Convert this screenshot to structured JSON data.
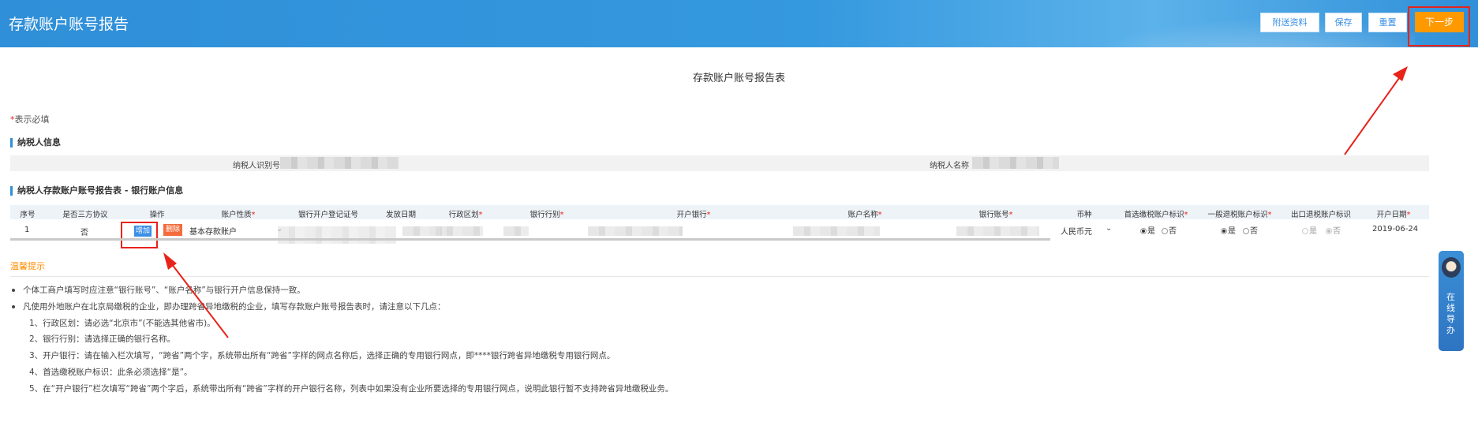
{
  "header": {
    "title": "存款账户账号报告",
    "buttons": {
      "attach": "附送资料",
      "save": "保存",
      "reset": "重置",
      "next": "下一步"
    }
  },
  "form": {
    "title": "存款账户账号报告表",
    "required_note_star": "*",
    "required_note": "表示必填",
    "section_taxpayer": "纳税人信息",
    "taxpayer_id_label": "纳税人识别号",
    "taxpayer_name_label": "纳税人名称",
    "section_bank": "纳税人存款账户账号报告表 - 银行账户信息"
  },
  "table": {
    "headers": [
      {
        "text": "序号",
        "required": false
      },
      {
        "text": "是否三方协议",
        "required": false
      },
      {
        "text": "操作",
        "required": false
      },
      {
        "text": "账户性质",
        "required": true
      },
      {
        "text": "银行开户登记证号",
        "required": false
      },
      {
        "text": "发放日期",
        "required": false
      },
      {
        "text": "行政区划",
        "required": true
      },
      {
        "text": "银行行别",
        "required": true
      },
      {
        "text": "开户银行",
        "required": true
      },
      {
        "text": "账户名称",
        "required": true
      },
      {
        "text": "银行账号",
        "required": true
      },
      {
        "text": "币种",
        "required": false
      },
      {
        "text": "首选缴税账户标识",
        "required": true
      },
      {
        "text": "一般退税账户标识",
        "required": true
      },
      {
        "text": "出口退税账户标识",
        "required": false
      },
      {
        "text": "开户日期",
        "required": true
      }
    ],
    "row": {
      "index": "1",
      "tripartite": "否",
      "add_label": "增加",
      "delete_label": "删除",
      "account_type": "基本存款账户",
      "currency": "人民币元",
      "yes": "是",
      "no": "否",
      "open_date": "2019-06-24"
    }
  },
  "tips": {
    "title": "温馨提示",
    "items": [
      "个体工商户填写时应注意“银行账号”、“账户名称”与银行开户信息保持一致。",
      "凡使用外地账户在北京局缴税的企业，即办理跨省异地缴税的企业，填写存款账户账号报告表时，请注意以下几点：",
      "1、行政区划：请必选“北京市”(不能选其他省市)。",
      "2、银行行别：请选择正确的银行名称。",
      "3、开户银行：请在输入栏次填写，“跨省”两个字，系统带出所有“跨省”字样的网点名称后，选择正确的专用银行网点，即****银行跨省异地缴税专用银行网点。",
      "4、首选缴税账户标识：此条必须选择“是”。",
      "5、在“开户银行”栏次填写“跨省”两个字后，系统带出所有“跨省”字样的开户银行名称，列表中如果没有企业所要选择的专用银行网点，说明此银行暂不支持跨省异地缴税业务。"
    ]
  },
  "online_guide": "在线导办",
  "colors": {
    "header_blue": "#2f8fd8",
    "next_orange": "#ff9900",
    "annotation_red": "#e8231a",
    "tips_orange": "#ff8c00"
  }
}
